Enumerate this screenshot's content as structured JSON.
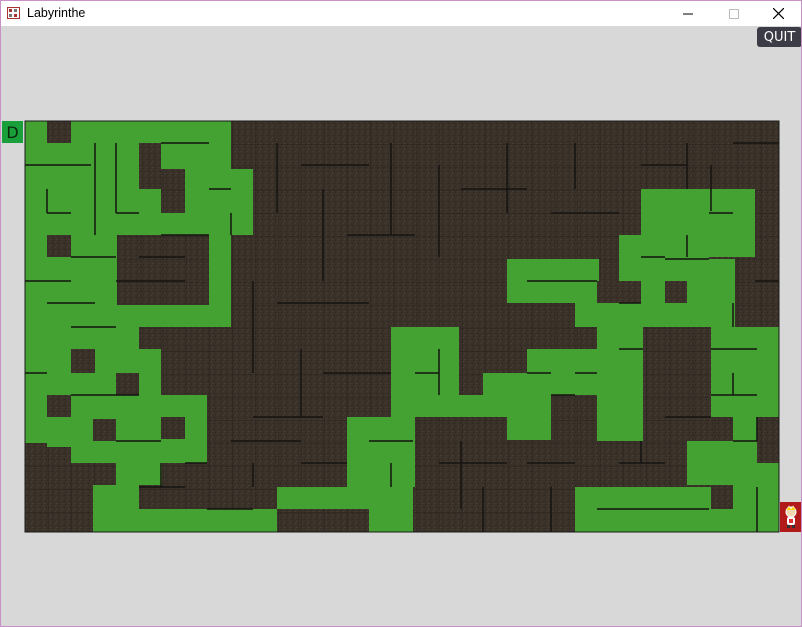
{
  "window": {
    "title": "Labyrinthe"
  },
  "controls": {
    "quit_label": "QUIT"
  },
  "maze": {
    "start_label": "D",
    "colors": {
      "wall_bg": "#3a3129",
      "path": "#43a232",
      "start": "#19a03a",
      "goal": "#b21a1a",
      "line": "#1c1c1c"
    },
    "goal_icon": "character-icon"
  }
}
